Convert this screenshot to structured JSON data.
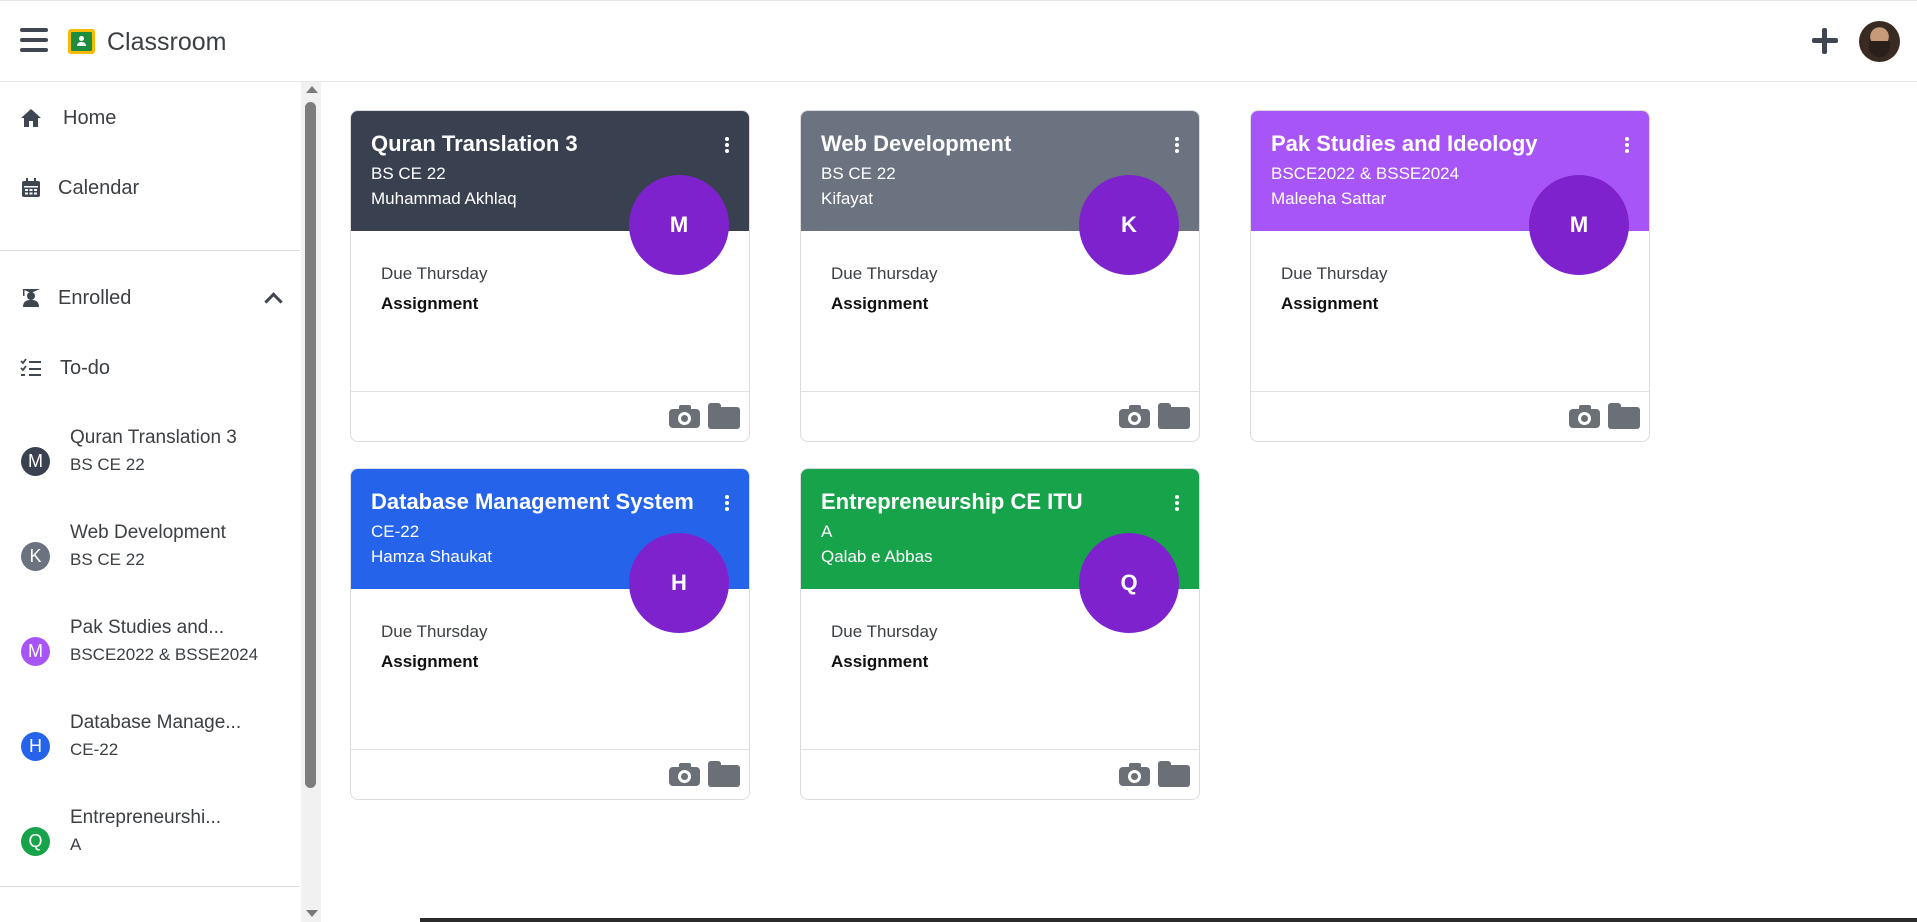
{
  "header": {
    "app_title": "Classroom",
    "menu_icon": "hamburger-menu-icon",
    "create_icon": "plus-icon",
    "account_icon": "user-avatar"
  },
  "sidebar": {
    "home_label": "Home",
    "calendar_label": "Calendar",
    "enrolled_label": "Enrolled",
    "todo_label": "To-do",
    "classes": [
      {
        "initial": "M",
        "name": "Quran Translation 3",
        "section": "BS CE 22",
        "color": "#3a4150"
      },
      {
        "initial": "K",
        "name": "Web Development",
        "section": "BS CE 22",
        "color": "#6b7280"
      },
      {
        "initial": "M",
        "name": "Pak Studies and...",
        "section": "BSCE2022 & BSSE2024",
        "color": "#a855f7"
      },
      {
        "initial": "H",
        "name": "Database Manage...",
        "section": "CE-22",
        "color": "#2563eb"
      },
      {
        "initial": "Q",
        "name": "Entrepreneurshi...",
        "section": "A",
        "color": "#16a34a"
      }
    ]
  },
  "cards": [
    {
      "title": "Quran Translation 3",
      "section": "BS CE 22",
      "teacher": "Muhammad Akhlaq",
      "initial": "M",
      "color": "#394150",
      "due": "Due Thursday",
      "assignment": "Assignment"
    },
    {
      "title": "Web Development",
      "section": "BS CE 22",
      "teacher": "Kifayat",
      "initial": "K",
      "color": "#6b7280",
      "due": "Due Thursday",
      "assignment": "Assignment"
    },
    {
      "title": "Pak Studies and Ideology",
      "section": "BSCE2022 & BSSE2024",
      "teacher": "Maleeha Sattar",
      "initial": "M",
      "color": "#a855f7",
      "due": "Due Thursday",
      "assignment": "Assignment"
    },
    {
      "title": "Database Management System",
      "section": "CE-22",
      "teacher": "Hamza Shaukat",
      "initial": "H",
      "color": "#2563eb",
      "due": "Due Thursday",
      "assignment": "Assignment"
    },
    {
      "title": "Entrepreneurship CE ITU",
      "section": "A",
      "teacher": "Qalab e Abbas",
      "initial": "Q",
      "color": "#16a34a",
      "due": "Due Thursday",
      "assignment": "Assignment"
    }
  ],
  "colors": {
    "avatar_purple": "#7e22ce",
    "icon_gray": "#6b6f76"
  }
}
